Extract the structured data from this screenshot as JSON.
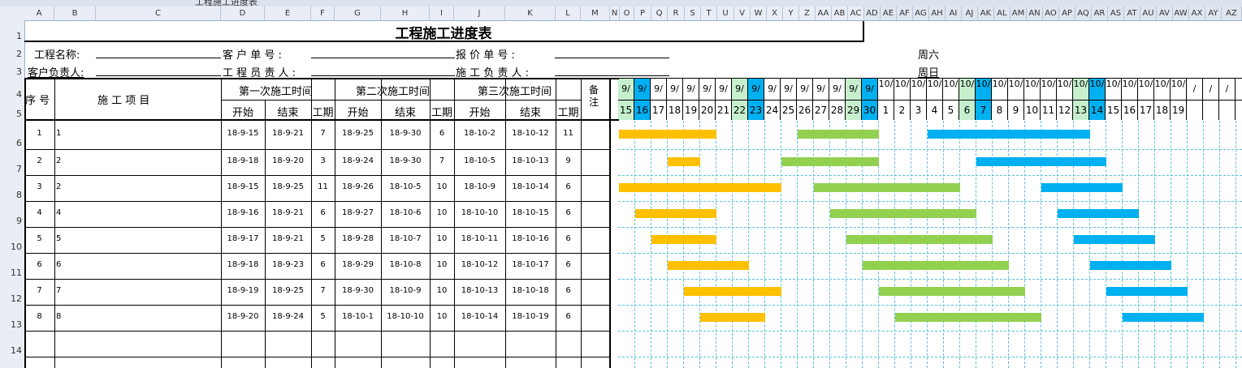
{
  "sheet": {
    "formula_fragment": "工程施工进度表",
    "columns": [
      "A",
      "B",
      "C",
      "D",
      "E",
      "F",
      "G",
      "H",
      "I",
      "J",
      "K",
      "L",
      "M",
      "N",
      "O",
      "P",
      "Q",
      "R",
      "S",
      "T",
      "U",
      "V",
      "W",
      "X",
      "Y",
      "Z",
      "AA",
      "AB",
      "AC",
      "AD",
      "AE",
      "AF",
      "AG",
      "AH",
      "AI",
      "AJ",
      "AK",
      "AL",
      "AM",
      "AN",
      "AO",
      "AP",
      "AQ",
      "AR",
      "AS",
      "AT",
      "AU",
      "AV",
      "AW",
      "AX",
      "AY",
      "AZ"
    ],
    "rows": [
      "1",
      "2",
      "3",
      "4",
      "5",
      "6",
      "7",
      "8",
      "9",
      "10",
      "11",
      "12",
      "13",
      "14"
    ]
  },
  "title": "工程施工进度表",
  "info": {
    "project_name_label": "工程名称:",
    "client_order_label": "客 户 单 号 :",
    "quote_no_label": "报  价  单  号 :",
    "client_lead_label": "客户负责人:",
    "project_lead_label": "工 程 员 责 人 :",
    "construction_lead_label": "施 工 负 责 人 :",
    "weekday_sat": "周六",
    "weekday_sun": "周日"
  },
  "headers": {
    "seq": "序 号",
    "item": "施  工  项  目",
    "phase1": "第一次施工时间",
    "phase2": "第二次施工时间",
    "phase3": "第三次施工时间",
    "start": "开始",
    "end": "结束",
    "duration": "工期",
    "note": "备注"
  },
  "date_header": {
    "months": [
      "9/",
      "9/",
      "9/",
      "9/",
      "9/",
      "9/",
      "9/",
      "9/",
      "9/",
      "9/",
      "9/",
      "9/",
      "9/",
      "9/",
      "9/",
      "9/",
      "10/",
      "10/",
      "10/",
      "10/",
      "10/",
      "10/",
      "10/",
      "10/",
      "10/",
      "10/",
      "10/",
      "10/",
      "10/",
      "10/",
      "10/",
      "10/",
      "10/",
      "10/",
      "10/",
      "/",
      "/",
      "/"
    ],
    "days": [
      "15",
      "16",
      "17",
      "18",
      "19",
      "20",
      "21",
      "22",
      "23",
      "24",
      "25",
      "26",
      "27",
      "28",
      "29",
      "30",
      "1",
      "2",
      "3",
      "4",
      "5",
      "6",
      "7",
      "8",
      "9",
      "10",
      "11",
      "12",
      "13",
      "14",
      "15",
      "16",
      "17",
      "18",
      "19",
      "",
      "",
      ""
    ],
    "weekend_green": [
      0,
      7,
      14,
      21,
      28
    ],
    "weekend_blue": [
      1,
      8,
      15,
      22,
      29
    ]
  },
  "rows": [
    {
      "seq": "1",
      "item": "1",
      "s1": "18-9-15",
      "e1": "18-9-21",
      "d1": "7",
      "s2": "18-9-25",
      "e2": "18-9-30",
      "d2": "6",
      "s3": "18-10-2",
      "e3": "18-10-12",
      "d3": "11"
    },
    {
      "seq": "2",
      "item": "2",
      "s1": "18-9-18",
      "e1": "18-9-20",
      "d1": "3",
      "s2": "18-9-24",
      "e2": "18-9-30",
      "d2": "7",
      "s3": "18-10-5",
      "e3": "18-10-13",
      "d3": "9"
    },
    {
      "seq": "3",
      "item": "2",
      "s1": "18-9-15",
      "e1": "18-9-25",
      "d1": "11",
      "s2": "18-9-26",
      "e2": "18-10-5",
      "d2": "10",
      "s3": "18-10-9",
      "e3": "18-10-14",
      "d3": "6"
    },
    {
      "seq": "4",
      "item": "4",
      "s1": "18-9-16",
      "e1": "18-9-21",
      "d1": "6",
      "s2": "18-9-27",
      "e2": "18-10-6",
      "d2": "10",
      "s3": "18-10-10",
      "e3": "18-10-15",
      "d3": "6"
    },
    {
      "seq": "5",
      "item": "5",
      "s1": "18-9-17",
      "e1": "18-9-21",
      "d1": "5",
      "s2": "18-9-28",
      "e2": "18-10-7",
      "d2": "10",
      "s3": "18-10-11",
      "e3": "18-10-16",
      "d3": "6"
    },
    {
      "seq": "6",
      "item": "6",
      "s1": "18-9-18",
      "e1": "18-9-23",
      "d1": "6",
      "s2": "18-9-29",
      "e2": "18-10-8",
      "d2": "10",
      "s3": "18-10-12",
      "e3": "18-10-17",
      "d3": "6"
    },
    {
      "seq": "7",
      "item": "7",
      "s1": "18-9-19",
      "e1": "18-9-25",
      "d1": "7",
      "s2": "18-9-30",
      "e2": "18-10-9",
      "d2": "10",
      "s3": "18-10-13",
      "e3": "18-10-18",
      "d3": "6"
    },
    {
      "seq": "8",
      "item": "8",
      "s1": "18-9-20",
      "e1": "18-9-24",
      "d1": "5",
      "s2": "18-10-1",
      "e2": "18-10-10",
      "d2": "10",
      "s3": "18-10-14",
      "e3": "18-10-19",
      "d3": "6"
    }
  ],
  "gantt": [
    [
      [
        0,
        6
      ],
      [
        11,
        16
      ],
      [
        19,
        29
      ]
    ],
    [
      [
        3,
        5
      ],
      [
        10,
        16
      ],
      [
        22,
        30
      ]
    ],
    [
      [
        0,
        10
      ],
      [
        12,
        21
      ],
      [
        26,
        31
      ]
    ],
    [
      [
        1,
        6
      ],
      [
        13,
        22
      ],
      [
        27,
        32
      ]
    ],
    [
      [
        2,
        6
      ],
      [
        14,
        23
      ],
      [
        28,
        33
      ]
    ],
    [
      [
        3,
        8
      ],
      [
        15,
        24
      ],
      [
        29,
        34
      ]
    ],
    [
      [
        4,
        10
      ],
      [
        16,
        25
      ],
      [
        30,
        35
      ]
    ],
    [
      [
        5,
        9
      ],
      [
        17,
        26
      ],
      [
        31,
        36
      ]
    ]
  ],
  "colors": {
    "phase1": "#ffc000",
    "phase2": "#92d050",
    "phase3": "#00b0f0",
    "weekend_green": "#c6efce",
    "weekend_blue": "#00b0f0"
  }
}
